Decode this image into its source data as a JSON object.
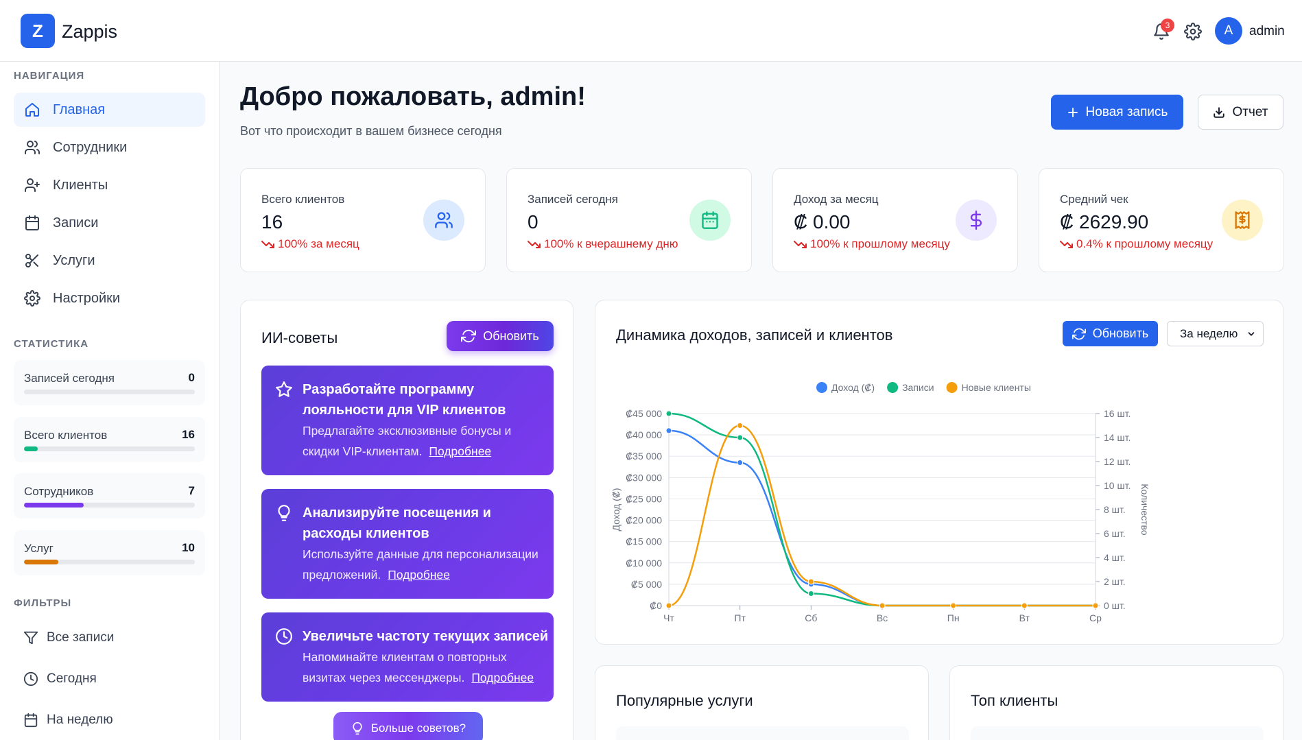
{
  "app": {
    "logo_letter": "Z",
    "name": "Zappis"
  },
  "header": {
    "notifications_count": "3",
    "avatar_letter": "A",
    "username": "admin"
  },
  "sidebar": {
    "nav_title": "НАВИГАЦИЯ",
    "nav": [
      {
        "label": "Главная",
        "icon": "home-icon",
        "active": true
      },
      {
        "label": "Сотрудники",
        "icon": "users-icon"
      },
      {
        "label": "Клиенты",
        "icon": "user-plus-icon"
      },
      {
        "label": "Записи",
        "icon": "calendar-icon"
      },
      {
        "label": "Услуги",
        "icon": "scissors-icon"
      },
      {
        "label": "Настройки",
        "icon": "gear-icon"
      }
    ],
    "stats_title": "СТАТИСТИКА",
    "stats": [
      {
        "label": "Записей сегодня",
        "value": "0",
        "fill": 0,
        "color": "#2563eb"
      },
      {
        "label": "Всего клиентов",
        "value": "16",
        "fill": 0.08,
        "color": "#10b981"
      },
      {
        "label": "Сотрудников",
        "value": "7",
        "fill": 0.35,
        "color": "#7c3aed"
      },
      {
        "label": "Услуг",
        "value": "10",
        "fill": 0.2,
        "color": "#d97706"
      }
    ],
    "filters_title": "ФИЛЬТРЫ",
    "filters": [
      {
        "label": "Все записи",
        "icon": "filter-icon"
      },
      {
        "label": "Сегодня",
        "icon": "clock-icon"
      },
      {
        "label": "На неделю",
        "icon": "calendar-icon"
      }
    ]
  },
  "main": {
    "title": "Добро пожаловать, admin!",
    "subtitle": "Вот что происходит в вашем бизнесе сегодня",
    "new_record_label": "Новая запись",
    "report_label": "Отчет",
    "kpis": [
      {
        "label": "Всего клиентов",
        "value": "16",
        "change": "100% за месяц",
        "icon": "users-icon",
        "icon_bg": "#dbeafe",
        "icon_color": "#2563eb"
      },
      {
        "label": "Записей сегодня",
        "value": "0",
        "change": "100% к вчерашнему дню",
        "icon": "calendar-icon",
        "icon_bg": "#d1fae5",
        "icon_color": "#10b981"
      },
      {
        "label": "Доход за месяц",
        "value": "₡ 0.00",
        "change": "100% к прошлому месяцу",
        "icon": "dollar-icon",
        "icon_bg": "#ede9fe",
        "icon_color": "#7c3aed"
      },
      {
        "label": "Средний чек",
        "value": "₡ 2629.90",
        "change": "0.4% к прошлому месяцу",
        "icon": "receipt-icon",
        "icon_bg": "#fef3c7",
        "icon_color": "#d97706"
      }
    ]
  },
  "ai_tips": {
    "title": "ИИ-советы",
    "refresh_label": "Обновить",
    "tips": [
      {
        "icon": "star-icon",
        "title": "Разработайте программу лояльности для VIP клиентов",
        "desc": "Предлагайте эксклюзивные бонусы и скидки VIP-клиентам.",
        "link": "Подробнее"
      },
      {
        "icon": "lightbulb-icon",
        "title": "Анализируйте посещения и расходы клиентов",
        "desc": "Используйте данные для персонализации предложений.",
        "link": "Подробнее"
      },
      {
        "icon": "clock-icon",
        "title": "Увеличьте частоту текущих записей",
        "desc": "Напоминайте клиентам о повторных визитах через мессенджеры.",
        "link": "Подробнее"
      }
    ],
    "more_label": "Больше советов?"
  },
  "chart_card": {
    "title": "Динамика доходов, записей и клиентов",
    "refresh_label": "Обновить",
    "period_selected": "За неделю"
  },
  "chart_data": {
    "type": "line",
    "categories": [
      "Чт",
      "Пт",
      "Сб",
      "Вс",
      "Пн",
      "Вт",
      "Ср"
    ],
    "series": [
      {
        "name": "Доход (₡)",
        "axis": "left",
        "color": "#3b82f6",
        "values": [
          41000,
          33500,
          5000,
          0,
          0,
          0,
          0
        ]
      },
      {
        "name": "Записи",
        "axis": "right",
        "color": "#10b981",
        "values": [
          16,
          14,
          1,
          0,
          0,
          0,
          0
        ]
      },
      {
        "name": "Новые клиенты",
        "axis": "right",
        "color": "#f59e0b",
        "values": [
          0,
          15,
          2,
          0,
          0,
          0,
          0
        ]
      }
    ],
    "ylabel_left": "Доход (₡)",
    "ylabel_right": "Количество",
    "ylim_left": [
      0,
      45000
    ],
    "ylim_right": [
      0,
      16
    ],
    "left_ticks": [
      "₡0",
      "₡5 000",
      "₡10 000",
      "₡15 000",
      "₡20 000",
      "₡25 000",
      "₡30 000",
      "₡35 000",
      "₡40 000",
      "₡45 000"
    ],
    "right_ticks": [
      "0 шт.",
      "2 шт.",
      "4 шт.",
      "6 шт.",
      "8 шт.",
      "10 шт.",
      "12 шт.",
      "14 шт.",
      "16 шт."
    ],
    "grid": true,
    "legend": "top-center"
  },
  "bottom_cards": {
    "popular_services_title": "Популярные услуги",
    "top_clients_title": "Топ клиенты"
  }
}
